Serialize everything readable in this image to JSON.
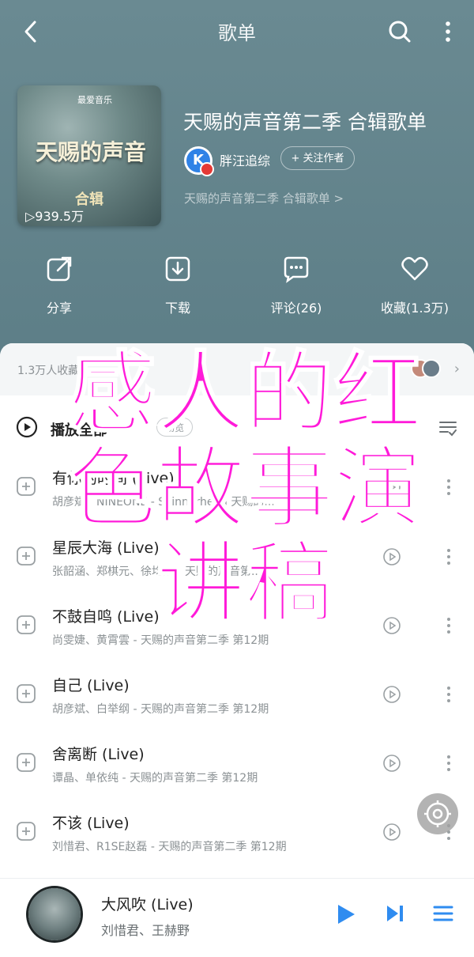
{
  "topbar": {
    "title": "歌单"
  },
  "playlist": {
    "cover_badge": "最爱音乐",
    "cover_logo": "天赐的声音",
    "cover_caption": "合辑",
    "play_count": "▷939.5万",
    "title": "天赐的声音第二季 合辑歌单",
    "author": "胖汪追综",
    "follow_label": "+ 关注作者",
    "description": "天赐的声音第二季 合辑歌单 >"
  },
  "actions": [
    {
      "label": "分享",
      "icon": "share-icon"
    },
    {
      "label": "下载",
      "icon": "download-icon"
    },
    {
      "label": "评论(26)",
      "icon": "comment-icon"
    },
    {
      "label": "收藏(1.3万)",
      "icon": "heart-icon"
    }
  ],
  "collect": {
    "text": "1.3万人收藏 ›",
    "arrow": "›"
  },
  "play_all": {
    "label": "播放全部",
    "tag": "畅览"
  },
  "songs": [
    {
      "title": "有你的时间 (Live)",
      "sub": "胡彦斌、NINEONE - Skinnerhead 天赐的..."
    },
    {
      "title": "星辰大海 (Live)",
      "sub": "张韶涵、郑棋元、徐均朔 - 天赐的声音第..."
    },
    {
      "title": "不鼓自鸣 (Live)",
      "sub": "尚雯婕、黄霄雲 - 天赐的声音第二季 第12期"
    },
    {
      "title": "自己 (Live)",
      "sub": "胡彦斌、白举纲 - 天赐的声音第二季 第12期"
    },
    {
      "title": "舍离断 (Live)",
      "sub": "谭晶、单依纯 - 天赐的声音第二季 第12期"
    },
    {
      "title": "不该 (Live)",
      "sub": "刘惜君、R1SE赵磊 - 天赐的声音第二季 第12期"
    }
  ],
  "mini_player": {
    "title": "大风吹 (Live)",
    "artist": "刘惜君、王赫野"
  },
  "overlay": {
    "text": "感人的红色故事演讲稿"
  },
  "colors": {
    "accent": "#2f8cf0",
    "overlay": "#ff1ad9",
    "header_bg": "#5e7f88"
  }
}
